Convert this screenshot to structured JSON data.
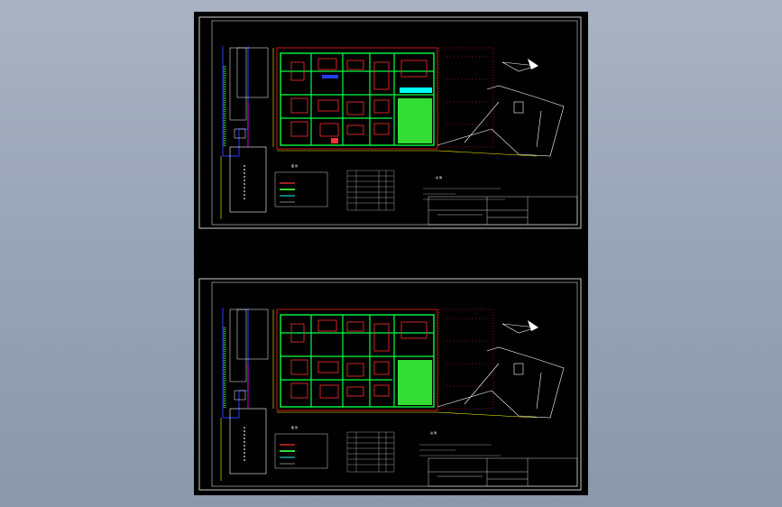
{
  "app": {
    "title": ""
  },
  "viewer": {
    "background_color": "#000000",
    "frame_color": "#ffffff",
    "sheets": [
      {
        "id": "top",
        "legend_title": "图 例",
        "table_title": "",
        "notes_title": "说 明",
        "title_block": ""
      },
      {
        "id": "bottom",
        "legend_title": "图 例",
        "table_title": "",
        "notes_title": "说 明",
        "title_block": ""
      }
    ]
  },
  "colors": {
    "site_boundary": "#ff2020",
    "road": "#00ff40",
    "building": "#ff3030",
    "yellow_line": "#ffff00",
    "blue_line": "#2040ff",
    "magenta": "#ff00ff",
    "cyan": "#00ffff",
    "grass": "#33dd33"
  },
  "icons": {
    "north_arrow": "north-arrow-icon"
  }
}
